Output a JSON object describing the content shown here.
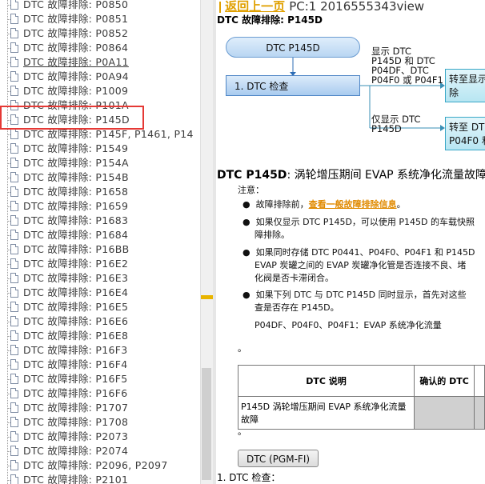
{
  "tree": {
    "items": [
      {
        "label": "DTC 故障排除: P0850"
      },
      {
        "label": "DTC 故障排除: P0851"
      },
      {
        "label": "DTC 故障排除: P0852"
      },
      {
        "label": "DTC 故障排除: P0864"
      },
      {
        "label": "DTC 故障排除: P0A11",
        "underline": true
      },
      {
        "label": "DTC 故障排除: P0A94"
      },
      {
        "label": "DTC 故障排除: P1009"
      },
      {
        "label": "DTC 故障排除: P101A"
      },
      {
        "label": "DTC 故障排除: P145D",
        "selected": true
      },
      {
        "label": "DTC 故障排除: P145F, P1461, P14"
      },
      {
        "label": "DTC 故障排除: P1549"
      },
      {
        "label": "DTC 故障排除: P154A"
      },
      {
        "label": "DTC 故障排除: P154B"
      },
      {
        "label": "DTC 故障排除: P1658"
      },
      {
        "label": "DTC 故障排除: P1659"
      },
      {
        "label": "DTC 故障排除: P1683"
      },
      {
        "label": "DTC 故障排除: P1684"
      },
      {
        "label": "DTC 故障排除: P16BB"
      },
      {
        "label": "DTC 故障排除: P16E2"
      },
      {
        "label": "DTC 故障排除: P16E3"
      },
      {
        "label": "DTC 故障排除: P16E4"
      },
      {
        "label": "DTC 故障排除: P16E5"
      },
      {
        "label": "DTC 故障排除: P16E6"
      },
      {
        "label": "DTC 故障排除: P16E8"
      },
      {
        "label": "DTC 故障排除: P16F3"
      },
      {
        "label": "DTC 故障排除: P16F4"
      },
      {
        "label": "DTC 故障排除: P16F5"
      },
      {
        "label": "DTC 故障排除: P16F6"
      },
      {
        "label": "DTC 故障排除: P1707"
      },
      {
        "label": "DTC 故障排除: P1708"
      },
      {
        "label": "DTC 故障排除: P2073"
      },
      {
        "label": "DTC 故障排除: P2074"
      },
      {
        "label": "DTC 故障排除: P2096, P2097"
      },
      {
        "label": "DTC 故障排除: P2101"
      }
    ]
  },
  "header": {
    "back_link": "返回上一页",
    "pc_text": "PC:1 2016555343view",
    "subtitle": "DTC 故障排除: P145D"
  },
  "flow": {
    "start": "DTC P145D",
    "step1": "1.  DTC 检查",
    "branch1_line1": "显示 DTC",
    "branch1_line2": "P145D 和 DTC",
    "branch1_line3": "P04DF、DTC",
    "branch1_line4": "P04F0 或 P04F1",
    "branch1_box_line1": "转至显示",
    "branch1_box_line2": "除",
    "branch2_line1": "仅显示 DTC",
    "branch2_line2": "P145D",
    "branch2_box_line1": "转至 DT",
    "branch2_box_line2": "P04F0 和"
  },
  "doc": {
    "title_code": "DTC P145D",
    "title_text": ": 涡轮增压期间 EVAP 系统净化流量故障",
    "note_label": "注意：",
    "bullet1_pre": "故障排除前，",
    "bullet1_link": "查看一般故障排除信息",
    "bullet1_post": "。",
    "bullet2": "如果仅显示 DTC P145D，可以使用 P145D 的车载快照",
    "bullet2b": "障排除。",
    "bullet3": "如果同时存储 DTC P0441、P04F0、P04F1 和 P145D",
    "bullet3b": "EVAP 炭罐之间的 EVAP 炭罐净化管是否连接不良、堵",
    "bullet3c": "化阀是否卡滞闭合。",
    "bullet4": "如果下列 DTC 与 DTC P145D 同时显示，首先对这些",
    "bullet4b": "查是否存在 P145D。",
    "bullet4_codes": "P04DF、P04F0、P04F1：EVAP 系统净化流量",
    "dot1": "。",
    "table_h1": "DTC 说明",
    "table_h2": "确认的 DTC",
    "table_r1_line1": "P145D 涡轮增压期间 EVAP 系统净化流量",
    "table_r1_line2": "故障",
    "dot2": "。",
    "pgm_button": "DTC (PGM-FI)",
    "step_heading": "1.  DTC 检查："
  },
  "colors": {
    "highlight": "#e53935",
    "link_orange": "#e08a00"
  }
}
